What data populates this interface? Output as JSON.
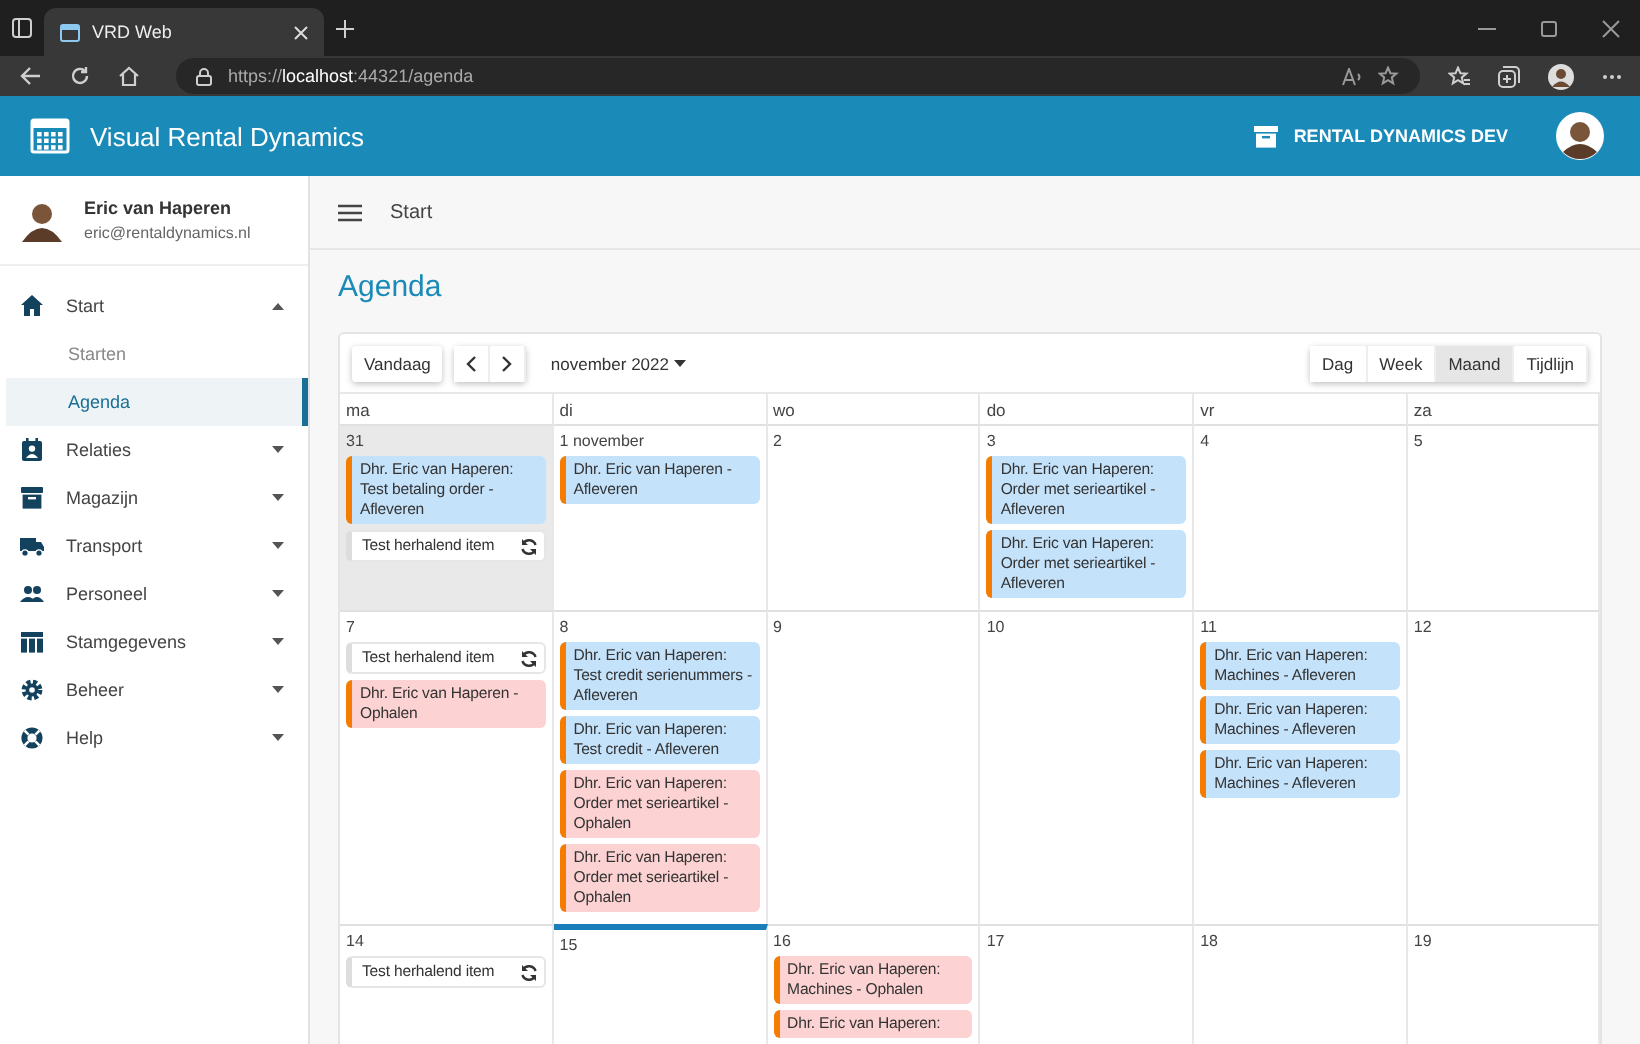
{
  "browser": {
    "tab_title": "VRD Web",
    "url": "https://**localhost**:44321/agenda"
  },
  "app_bar": {
    "title": "Visual Rental Dynamics",
    "environment": "RENTAL DYNAMICS DEV"
  },
  "user": {
    "name": "Eric van Haperen",
    "email": "eric@rentaldynamics.nl"
  },
  "nav": [
    {
      "label": "Start",
      "selected": false,
      "expanded": true,
      "children": [
        {
          "label": "Starten",
          "selected": false
        },
        {
          "label": "Agenda",
          "selected": true
        }
      ]
    },
    {
      "label": "Relaties",
      "selected": false,
      "expanded": false
    },
    {
      "label": "Magazijn",
      "selected": false,
      "expanded": false
    },
    {
      "label": "Transport",
      "selected": false,
      "expanded": false
    },
    {
      "label": "Personeel",
      "selected": false,
      "expanded": false
    },
    {
      "label": "Stamgegevens",
      "selected": false,
      "expanded": false
    },
    {
      "label": "Beheer",
      "selected": false,
      "expanded": false
    },
    {
      "label": "Help",
      "selected": false,
      "expanded": false
    }
  ],
  "breadcrumb": "Start",
  "page_title": "Agenda",
  "calendar": {
    "today_button": "Vandaag",
    "period": "november 2022",
    "views": [
      {
        "label": "Dag",
        "selected": false
      },
      {
        "label": "Week",
        "selected": false
      },
      {
        "label": "Maand",
        "selected": true
      },
      {
        "label": "Tijdlijn",
        "selected": false
      }
    ],
    "weekdays": [
      "ma",
      "di",
      "wo",
      "do",
      "vr",
      "za"
    ],
    "weeks": [
      {
        "days": [
          {
            "label": "31",
            "outside": true,
            "today": false,
            "events": [
              {
                "kind": "delivery",
                "text": "Dhr. Eric van Haperen: Test betaling order - Afleveren"
              },
              {
                "kind": "recurring",
                "text": "Test herhalend item"
              }
            ]
          },
          {
            "label": "1 november",
            "outside": false,
            "today": false,
            "events": [
              {
                "kind": "delivery",
                "text": "Dhr. Eric van Haperen - Afleveren"
              }
            ]
          },
          {
            "label": "2",
            "outside": false,
            "today": false
          },
          {
            "label": "3",
            "outside": false,
            "today": false,
            "events": [
              {
                "kind": "delivery",
                "text": "Dhr. Eric van Haperen: Order met serieartikel - Afleveren"
              },
              {
                "kind": "delivery",
                "text": "Dhr. Eric van Haperen: Order met serieartikel - Afleveren"
              }
            ]
          },
          {
            "label": "4",
            "outside": false,
            "today": false
          },
          {
            "label": "5",
            "outside": false,
            "today": false
          }
        ]
      },
      {
        "days": [
          {
            "label": "7",
            "outside": false,
            "today": false,
            "events": [
              {
                "kind": "recurring",
                "text": "Test herhalend item"
              },
              {
                "kind": "pickup",
                "text": "Dhr. Eric van Haperen - Ophalen"
              }
            ]
          },
          {
            "label": "8",
            "outside": false,
            "today": false,
            "events": [
              {
                "kind": "delivery",
                "text": "Dhr. Eric van Haperen: Test credit serienummers - Afleveren"
              },
              {
                "kind": "delivery",
                "text": "Dhr. Eric van Haperen: Test credit - Afleveren"
              },
              {
                "kind": "pickup",
                "text": "Dhr. Eric van Haperen: Order met serieartikel - Ophalen"
              },
              {
                "kind": "pickup",
                "text": "Dhr. Eric van Haperen: Order met serieartikel - Ophalen"
              }
            ]
          },
          {
            "label": "9",
            "outside": false,
            "today": false
          },
          {
            "label": "10",
            "outside": false,
            "today": false
          },
          {
            "label": "11",
            "outside": false,
            "today": false,
            "events": [
              {
                "kind": "delivery",
                "text": "Dhr. Eric van Haperen: Machines - Afleveren"
              },
              {
                "kind": "delivery",
                "text": "Dhr. Eric van Haperen: Machines - Afleveren"
              },
              {
                "kind": "delivery",
                "text": "Dhr. Eric van Haperen: Machines - Afleveren"
              }
            ]
          },
          {
            "label": "12",
            "outside": false,
            "today": false
          }
        ]
      },
      {
        "days": [
          {
            "label": "14",
            "outside": false,
            "today": false,
            "events": [
              {
                "kind": "recurring",
                "text": "Test herhalend item"
              }
            ]
          },
          {
            "label": "15",
            "outside": false,
            "today": true
          },
          {
            "label": "16",
            "outside": false,
            "today": false,
            "events": [
              {
                "kind": "pickup",
                "text": "Dhr. Eric van Haperen: Machines - Ophalen"
              },
              {
                "kind": "pickup",
                "text": "Dhr. Eric van Haperen:"
              }
            ]
          },
          {
            "label": "17",
            "outside": false,
            "today": false
          },
          {
            "label": "18",
            "outside": false,
            "today": false
          },
          {
            "label": "19",
            "outside": false,
            "today": false
          }
        ]
      }
    ]
  }
}
